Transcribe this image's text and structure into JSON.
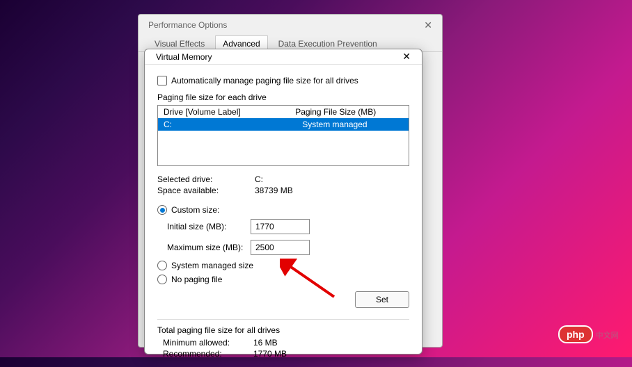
{
  "parent": {
    "title": "Performance Options",
    "tabs": [
      "Visual Effects",
      "Advanced",
      "Data Execution Prevention"
    ],
    "active_tab_index": 1
  },
  "vm": {
    "title": "Virtual Memory",
    "auto_manage_label": "Automatically manage paging file size for all drives",
    "auto_manage_checked": false,
    "section_label": "Paging file size for each drive",
    "list_header": {
      "col1": "Drive  [Volume Label]",
      "col2": "Paging File Size (MB)"
    },
    "drives": [
      {
        "drive": "C:",
        "size": "System managed"
      }
    ],
    "selected_drive_label": "Selected drive:",
    "selected_drive_value": "C:",
    "space_available_label": "Space available:",
    "space_available_value": "38739 MB",
    "custom_size_label": "Custom size:",
    "initial_size_label": "Initial size (MB):",
    "initial_size_value": "1770",
    "maximum_size_label": "Maximum size (MB):",
    "maximum_size_value": "2500",
    "system_managed_label": "System managed size",
    "no_paging_label": "No paging file",
    "set_button": "Set",
    "totals_label": "Total paging file size for all drives",
    "min_allowed_label": "Minimum allowed:",
    "min_allowed_value": "16 MB",
    "recommended_label": "Recommended:",
    "recommended_value": "1770 MB",
    "selected_radio": "custom"
  },
  "watermark": {
    "brand": "php",
    "text": "中文网"
  }
}
